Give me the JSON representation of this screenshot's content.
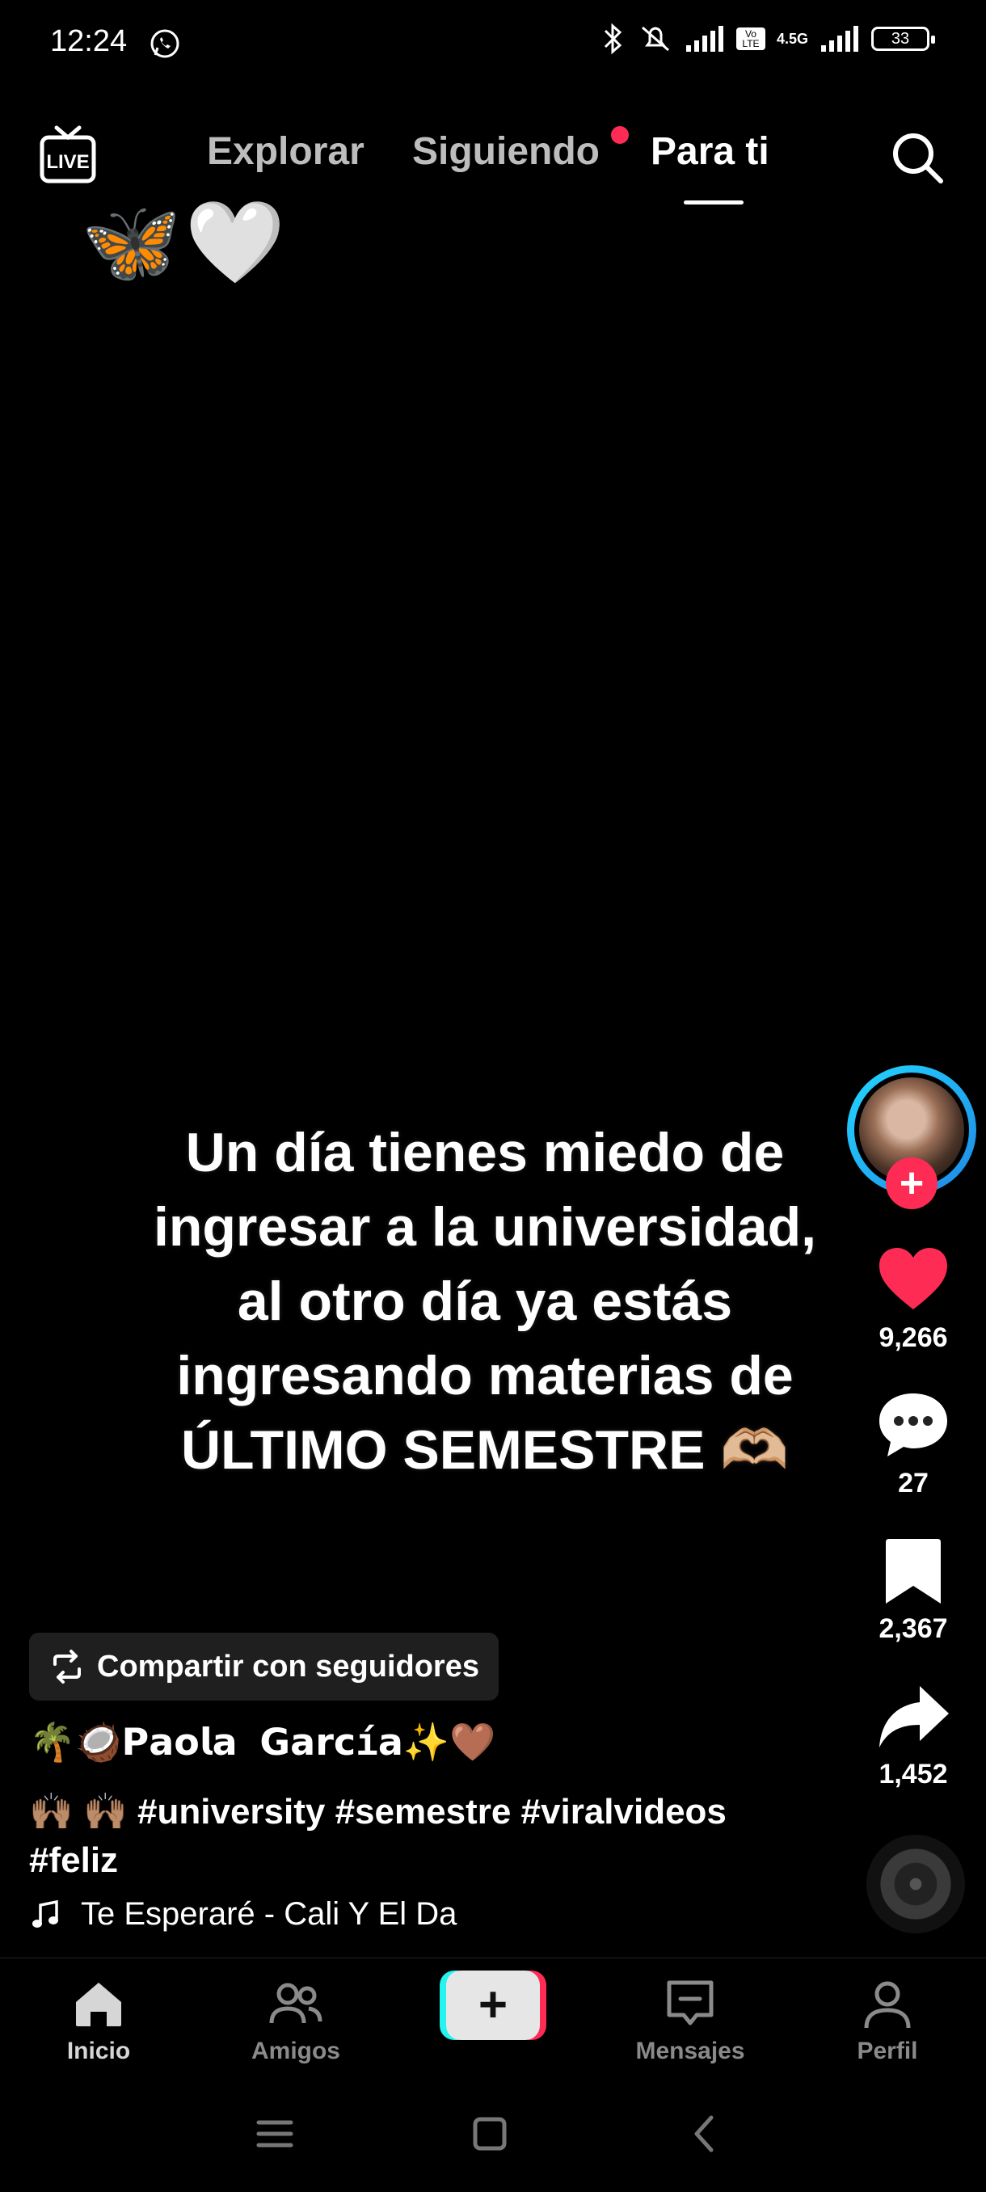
{
  "status_bar": {
    "time": "12:24",
    "battery": "33",
    "network": "4.5G",
    "volte": "Vo LTE"
  },
  "top_nav": {
    "live_label": "LIVE",
    "tabs": [
      {
        "label": "Explorar"
      },
      {
        "label": "Siguiendo"
      },
      {
        "label": "Para ti"
      }
    ]
  },
  "overlay_emojis": "🦋🤍",
  "video_caption_lines": [
    "Un día tienes miedo de",
    "ingresar a la universidad,",
    "al otro día ya estás",
    "ingresando materias de",
    "ÚLTIMO SEMESTRE 🫶🏼"
  ],
  "rail": {
    "likes": "9,266",
    "comments": "27",
    "saves": "2,367",
    "shares": "1,452",
    "follow_symbol": "+"
  },
  "share_pill": "Compartir con seguidores",
  "author": "🌴🥥𝗣𝗮𝗼𝗹𝗮 𝗚𝗮𝗿𝗰í𝗮✨🤎",
  "description": "🙌🏽 🙌🏽 #university #semestre #viralvideos #feliz",
  "music": "Te Esperaré - Cali Y El Da",
  "bottom_nav": {
    "home": "Inicio",
    "friends": "Amigos",
    "create": "+",
    "messages": "Mensajes",
    "profile": "Perfil"
  },
  "colors": {
    "accent": "#fe2c55",
    "cyan": "#25f4ee",
    "background": "#000000"
  }
}
